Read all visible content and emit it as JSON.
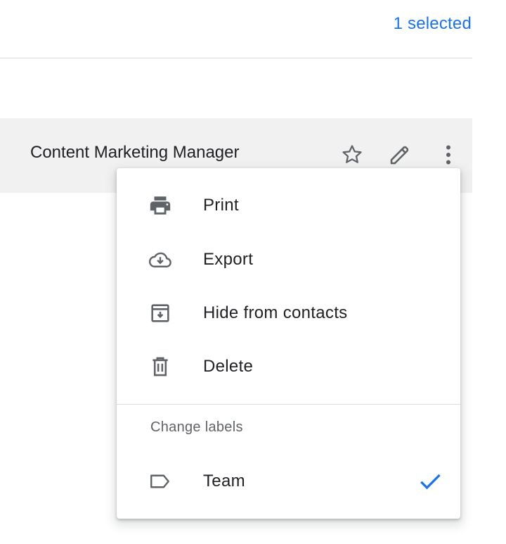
{
  "header": {
    "selected_count": "1 selected"
  },
  "contact": {
    "name": "Content Marketing Manager",
    "actions": [
      "star-icon",
      "pencil-icon",
      "more-vert-icon"
    ]
  },
  "menu": {
    "items": [
      {
        "label": "Print",
        "icon": "printer-icon"
      },
      {
        "label": "Export",
        "icon": "cloud-download-icon"
      },
      {
        "label": "Hide from contacts",
        "icon": "archive-icon"
      },
      {
        "label": "Delete",
        "icon": "trash-icon"
      }
    ],
    "labels_section": {
      "header": "Change labels",
      "labels": [
        {
          "label": "Team",
          "icon": "label-icon",
          "checked": true
        }
      ]
    }
  },
  "colors": {
    "accent": "#1a73e8",
    "icon": "#5f6368",
    "row_background": "#f1f1f1"
  }
}
